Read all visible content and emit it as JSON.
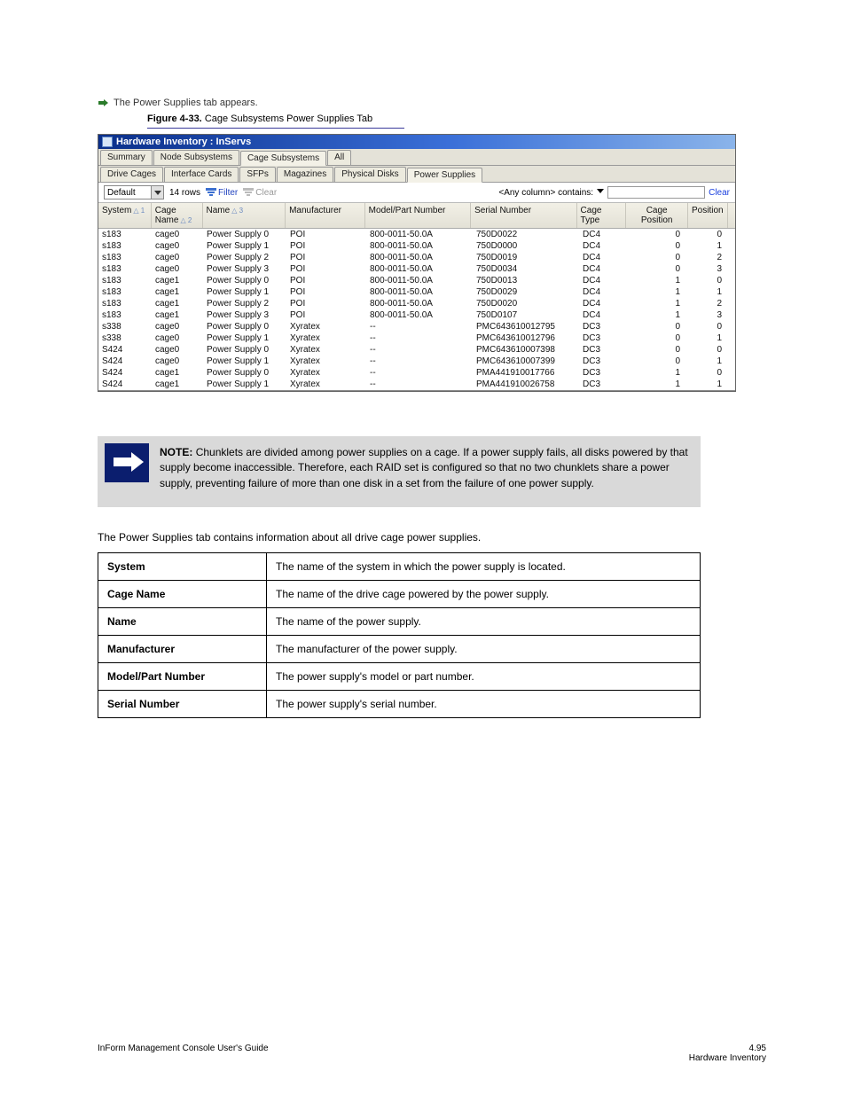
{
  "breadcrumb": "The Power Supplies tab appears.",
  "figure": {
    "label": "Figure 4-33.",
    "caption": "Cage Subsystems Power Supplies Tab"
  },
  "window": {
    "title": "Hardware Inventory : InServs",
    "tabs1": [
      "Summary",
      "Node Subsystems",
      "Cage Subsystems",
      "All"
    ],
    "tabs1_active": 2,
    "tabs2": [
      "Drive Cages",
      "Interface Cards",
      "SFPs",
      "Magazines",
      "Physical Disks",
      "Power Supplies"
    ],
    "tabs2_active": 5,
    "toolbar": {
      "combo_value": "Default",
      "rowcount": "14 rows",
      "filter": "Filter",
      "clear_disabled": "Clear",
      "any_column": "<Any column> contains:",
      "clear": "Clear"
    },
    "headers": {
      "system": "System",
      "system_sort": "△ 1",
      "cage": "Cage Name",
      "cage_sort": "△ 2",
      "name": "Name",
      "name_sort": "△ 3",
      "manufacturer": "Manufacturer",
      "model": "Model/Part Number",
      "serial": "Serial Number",
      "cagetype": "Cage Type",
      "cagepos": "Cage Position",
      "position": "Position"
    },
    "rows": [
      {
        "sys": "s183",
        "cage": "cage0",
        "name": "Power Supply 0",
        "man": "POI",
        "model": "800-0011-50.0A",
        "serial": "750D0022",
        "ctype": "DC4",
        "cpos": "0",
        "pos": "0"
      },
      {
        "sys": "s183",
        "cage": "cage0",
        "name": "Power Supply 1",
        "man": "POI",
        "model": "800-0011-50.0A",
        "serial": "750D0000",
        "ctype": "DC4",
        "cpos": "0",
        "pos": "1"
      },
      {
        "sys": "s183",
        "cage": "cage0",
        "name": "Power Supply 2",
        "man": "POI",
        "model": "800-0011-50.0A",
        "serial": "750D0019",
        "ctype": "DC4",
        "cpos": "0",
        "pos": "2"
      },
      {
        "sys": "s183",
        "cage": "cage0",
        "name": "Power Supply 3",
        "man": "POI",
        "model": "800-0011-50.0A",
        "serial": "750D0034",
        "ctype": "DC4",
        "cpos": "0",
        "pos": "3"
      },
      {
        "sys": "s183",
        "cage": "cage1",
        "name": "Power Supply 0",
        "man": "POI",
        "model": "800-0011-50.0A",
        "serial": "750D0013",
        "ctype": "DC4",
        "cpos": "1",
        "pos": "0"
      },
      {
        "sys": "s183",
        "cage": "cage1",
        "name": "Power Supply 1",
        "man": "POI",
        "model": "800-0011-50.0A",
        "serial": "750D0029",
        "ctype": "DC4",
        "cpos": "1",
        "pos": "1"
      },
      {
        "sys": "s183",
        "cage": "cage1",
        "name": "Power Supply 2",
        "man": "POI",
        "model": "800-0011-50.0A",
        "serial": "750D0020",
        "ctype": "DC4",
        "cpos": "1",
        "pos": "2"
      },
      {
        "sys": "s183",
        "cage": "cage1",
        "name": "Power Supply 3",
        "man": "POI",
        "model": "800-0011-50.0A",
        "serial": "750D0107",
        "ctype": "DC4",
        "cpos": "1",
        "pos": "3"
      },
      {
        "sys": "s338",
        "cage": "cage0",
        "name": "Power Supply 0",
        "man": "Xyratex",
        "model": "--",
        "serial": "PMC643610012795",
        "ctype": "DC3",
        "cpos": "0",
        "pos": "0"
      },
      {
        "sys": "s338",
        "cage": "cage0",
        "name": "Power Supply 1",
        "man": "Xyratex",
        "model": "--",
        "serial": "PMC643610012796",
        "ctype": "DC3",
        "cpos": "0",
        "pos": "1"
      },
      {
        "sys": "S424",
        "cage": "cage0",
        "name": "Power Supply 0",
        "man": "Xyratex",
        "model": "--",
        "serial": "PMC643610007398",
        "ctype": "DC3",
        "cpos": "0",
        "pos": "0"
      },
      {
        "sys": "S424",
        "cage": "cage0",
        "name": "Power Supply 1",
        "man": "Xyratex",
        "model": "--",
        "serial": "PMC643610007399",
        "ctype": "DC3",
        "cpos": "0",
        "pos": "1"
      },
      {
        "sys": "S424",
        "cage": "cage1",
        "name": "Power Supply 0",
        "man": "Xyratex",
        "model": "--",
        "serial": "PMA441910017766",
        "ctype": "DC3",
        "cpos": "1",
        "pos": "0"
      },
      {
        "sys": "S424",
        "cage": "cage1",
        "name": "Power Supply 1",
        "man": "Xyratex",
        "model": "--",
        "serial": "PMA441910026758",
        "ctype": "DC3",
        "cpos": "1",
        "pos": "1"
      }
    ]
  },
  "note": {
    "label": "NOTE:",
    "text": "Chunklets are divided among power supplies on a cage. If a power supply fails, all disks powered by that supply become inaccessible. Therefore, each RAID set is configured so that no two chunklets share a power supply, preventing failure of more than one disk in a set from the failure of one power supply."
  },
  "para": "The Power Supplies tab contains information about all drive cage power supplies.",
  "defs": [
    {
      "k": "System",
      "v": "The name of the system in which the power supply is located."
    },
    {
      "k": "Cage Name",
      "v": "The name of the drive cage powered by the power supply."
    },
    {
      "k": "Name",
      "v": "The name of the power supply."
    },
    {
      "k": "Manufacturer",
      "v": "The manufacturer of the power supply."
    },
    {
      "k": "Model/Part Number",
      "v": "The power supply's model or part number."
    },
    {
      "k": "Serial Number",
      "v": "The power supply's serial number."
    }
  ],
  "footer": {
    "left": "InForm Management Console User's Guide",
    "chapter_no": "4.95",
    "chapter": "Hardware Inventory"
  }
}
